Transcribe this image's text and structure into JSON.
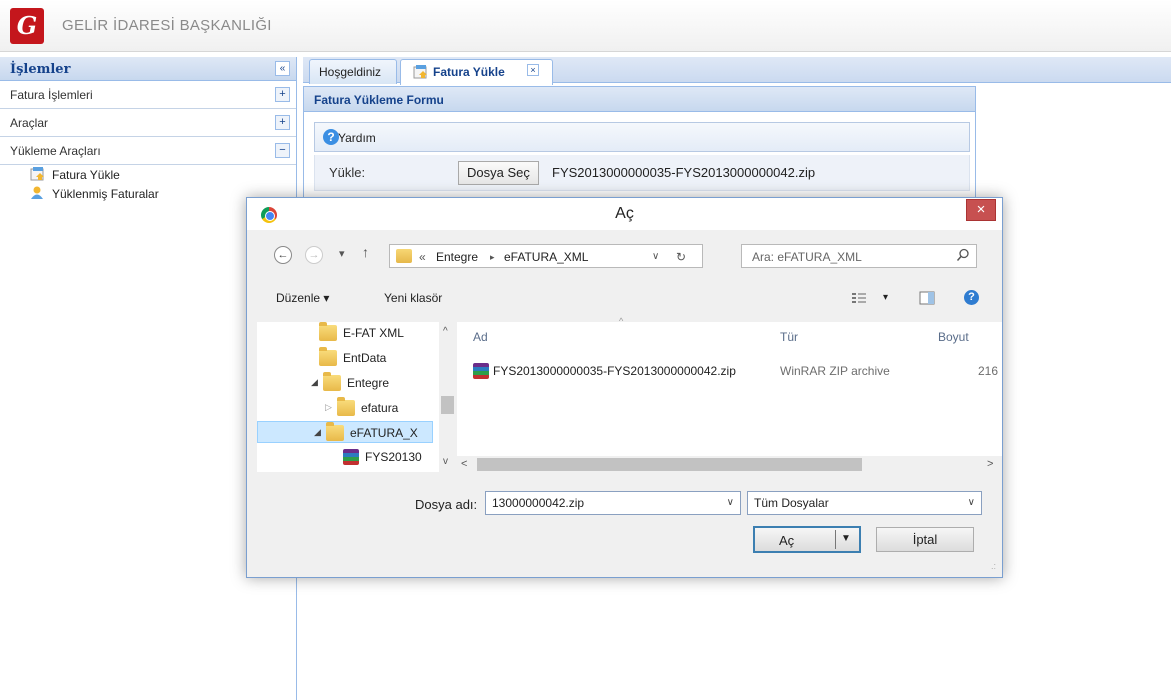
{
  "header": {
    "title": "GELİR İDARESİ BAŞKANLIĞI",
    "logo_letter": "G"
  },
  "sidebar": {
    "title": "İşlemler",
    "collapse_glyph": "«",
    "sections": [
      {
        "label": "Fatura İşlemleri",
        "toggle": "+"
      },
      {
        "label": "Araçlar",
        "toggle": "+"
      },
      {
        "label": "Yükleme Araçları",
        "toggle": "−"
      }
    ],
    "items": [
      "Fatura Yükle",
      "Yüklenmiş Faturalar"
    ]
  },
  "tabs": [
    {
      "label": "Hoşgeldiniz"
    },
    {
      "label": "Fatura Yükle",
      "close": "×"
    }
  ],
  "form": {
    "title": "Fatura Yükleme Formu",
    "help_label": "Yardım",
    "upload_label": "Yükle:",
    "choose_file_button": "Dosya Seç",
    "selected_file": "FYS2013000000035-FYS2013000000042.zip"
  },
  "dialog": {
    "title": "Aç",
    "close_glyph": "×",
    "breadcrumb": {
      "prefix": "«",
      "parts": [
        "Entegre",
        "eFATURA_XML"
      ]
    },
    "search_placeholder": "Ara: eFATURA_XML",
    "toolbar": {
      "organize": "Düzenle",
      "new_folder": "Yeni klasör"
    },
    "nav_tree": [
      {
        "label": "E-FAT XML"
      },
      {
        "label": "EntData"
      },
      {
        "label": "Entegre"
      },
      {
        "label": "efatura"
      },
      {
        "label": "eFATURA_X"
      },
      {
        "label": "FYS20130"
      }
    ],
    "columns": {
      "name": "Ad",
      "type": "Tür",
      "size": "Boyut"
    },
    "files": [
      {
        "name": "FYS2013000000035-FYS2013000000042.zip",
        "type": "WinRAR ZIP archive",
        "size": "216"
      }
    ],
    "filename_label": "Dosya adı:",
    "filename_value": "13000000042.zip",
    "filter": "Tüm Dosyalar",
    "open_button": "Aç",
    "cancel_button": "İptal"
  }
}
